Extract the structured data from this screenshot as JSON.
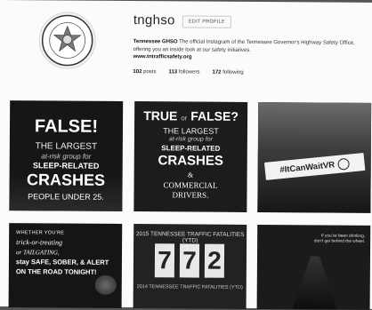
{
  "profile": {
    "username": "tnghso",
    "edit_label": "EDIT PROFILE",
    "bio_name": "Tennessee GHSO",
    "bio_text": "The official Instagram of the Tennessee Governor's Highway Safety Office, offering you an inside look at our safety initiatives.",
    "website": "www.tntrafficsafety.org",
    "stats": {
      "posts": "102",
      "posts_label": "posts",
      "followers": "113",
      "followers_label": "followers",
      "following": "172",
      "following_label": "following"
    }
  },
  "posts": {
    "p1": {
      "l1": "FALSE!",
      "l2": "THE LARGEST",
      "l3": "at-risk group for",
      "l4": "SLEEP-RELATED",
      "l5": "CRASHES",
      "l6": "PEOPLE UNDER 25."
    },
    "p2": {
      "true": "TRUE",
      "or": "or",
      "false": "FALSE?",
      "l2": "THE LARGEST",
      "l3": "at-risk group for",
      "l4": "SLEEP-RELATED",
      "l5": "CRASHES",
      "l6": "&",
      "l7": "COMMERCIAL",
      "l8": "DRIVERS."
    },
    "p3": {
      "banner": "#ItCanWaitVR"
    },
    "p4": {
      "a": "WHETHER YOU'RE",
      "b": "trick-or-treating",
      "c": "or TAILGATING,",
      "d": "stay SAFE, SOBER, & ALERT",
      "e": "ON THE ROAD TONIGHT!"
    },
    "p5": {
      "head": "2015 TENNESSEE TRAFFIC FATALITIES (YTD)",
      "digits": [
        "7",
        "7",
        "2"
      ],
      "foot": "2014 TENNESSEE TRAFFIC FATALITIES (YTD)"
    },
    "p6": {
      "line1": "If you've been drinking,",
      "line2": "don't get behind the wheel."
    }
  }
}
